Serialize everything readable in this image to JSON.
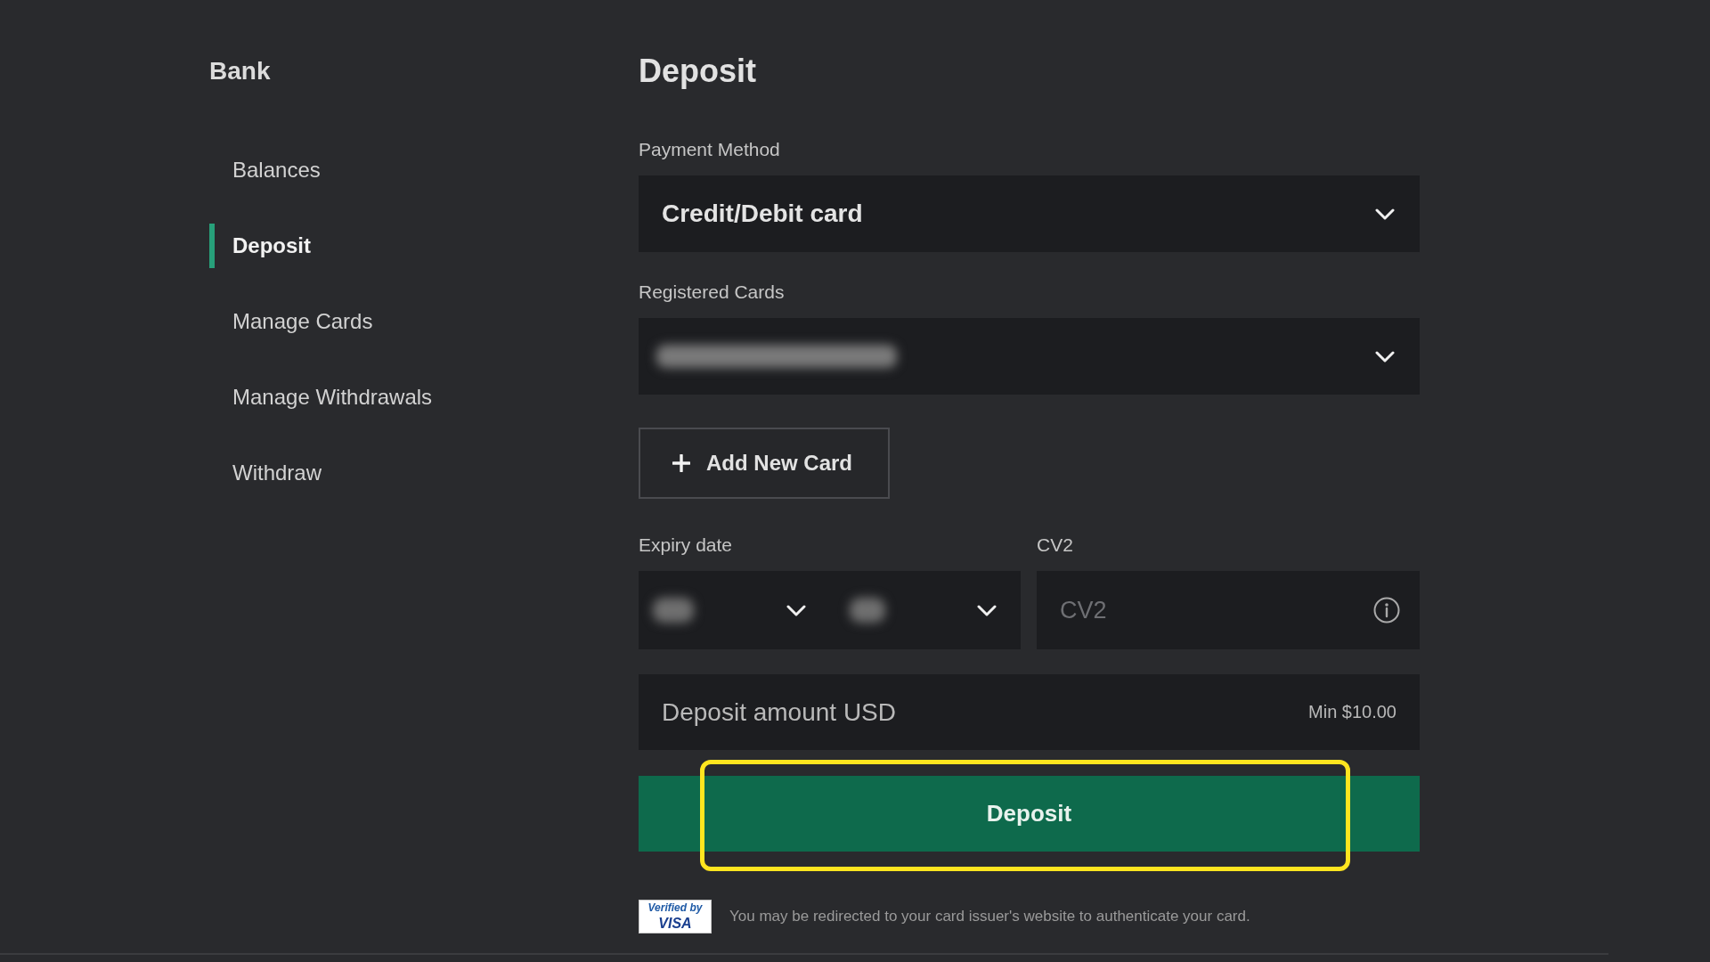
{
  "sidebar": {
    "title": "Bank",
    "items": [
      {
        "label": "Balances",
        "selected": false
      },
      {
        "label": "Deposit",
        "selected": true
      },
      {
        "label": "Manage Cards",
        "selected": false
      },
      {
        "label": "Manage Withdrawals",
        "selected": false
      },
      {
        "label": "Withdraw",
        "selected": false
      }
    ]
  },
  "form": {
    "title": "Deposit",
    "payment_method": {
      "label": "Payment Method",
      "value": "Credit/Debit card"
    },
    "registered_cards": {
      "label": "Registered Cards"
    },
    "add_card_button": {
      "label": "Add New Card"
    },
    "expiry_date": {
      "label": "Expiry date"
    },
    "cv2": {
      "label": "CV2",
      "placeholder": "CV2"
    },
    "deposit_amount": {
      "placeholder": "Deposit amount USD",
      "hint": "Min $10.00"
    },
    "deposit_button": {
      "label": "Deposit",
      "highlighted": true
    },
    "security_note": {
      "logo_line_1": "Verified by",
      "logo_line_2": "VISA",
      "text": "You may be redirected to your card issuer's website to authenticate your card."
    }
  }
}
